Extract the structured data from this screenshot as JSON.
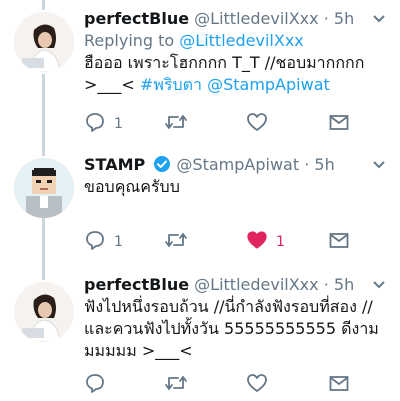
{
  "tweets": [
    {
      "author_name": "perfectBlue",
      "author_handle": "@LittledevilXxx",
      "dot": "·",
      "time": "5h",
      "reply_prefix": "Replying to ",
      "reply_handle": "@LittledevilXxx",
      "line1": "ฮือออ เพราะโฮกกกก T_T //ชอบมากกกก",
      "line2_text": ">___< ",
      "line2_hashtag": "#พริบตา",
      "line2_mention": "@StampApiwat",
      "reply_count": "1",
      "retweet_count": "",
      "like_count": ""
    },
    {
      "author_name": "STAMP",
      "author_handle": "@StampApiwat",
      "dot": "·",
      "time": "5h",
      "line1": "ขอบคุณครับบ",
      "reply_count": "1",
      "retweet_count": "",
      "like_count": "1"
    },
    {
      "author_name": "perfectBlue",
      "author_handle": "@LittledevilXxx",
      "dot": "·",
      "time": "5h",
      "line1": "ฟังไปหนึ่งรอบถ้วน //นี่กำลังฟังรอบที่สอง //",
      "line2": "และควนฟังไปทั้งวัน 55555555555 ดีงาม",
      "line3": "มมมมม >___<",
      "reply_count": "",
      "retweet_count": "",
      "like_count": ""
    }
  ],
  "colors": {
    "accent": "#1da1f2",
    "like": "#e0245e",
    "muted": "#657786",
    "thread_line": "#ccd6dd"
  }
}
